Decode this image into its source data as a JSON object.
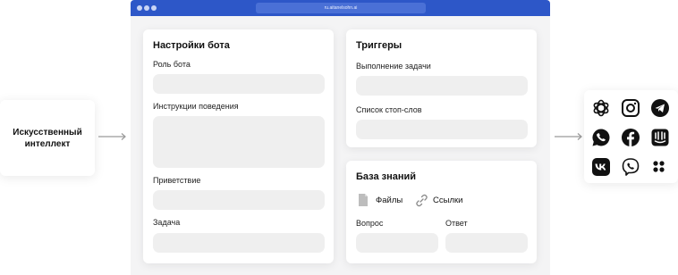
{
  "browser": {
    "url": "ru.aitanelsohn.ai"
  },
  "left_box": {
    "title": "Искусственный\nинтеллект"
  },
  "bot_settings": {
    "title": "Настройки бота",
    "fields": [
      {
        "label": "Роль бота"
      },
      {
        "label": "Инструкции поведения"
      },
      {
        "label": "Приветствие"
      },
      {
        "label": "Задача"
      }
    ]
  },
  "triggers": {
    "title": "Триггеры",
    "fields": [
      {
        "label": "Выполнение задачи"
      },
      {
        "label": "Список стоп-слов"
      }
    ]
  },
  "knowledge": {
    "title": "База знаний",
    "files_label": "Файлы",
    "links_label": "Ссылки",
    "question_label": "Вопрос",
    "answer_label": "Ответ"
  },
  "channels": [
    "openai-icon",
    "instagram-icon",
    "telegram-icon",
    "whatsapp-icon",
    "facebook-icon",
    "intercom-icon",
    "vk-icon",
    "viber-icon",
    "dots-icon"
  ]
}
